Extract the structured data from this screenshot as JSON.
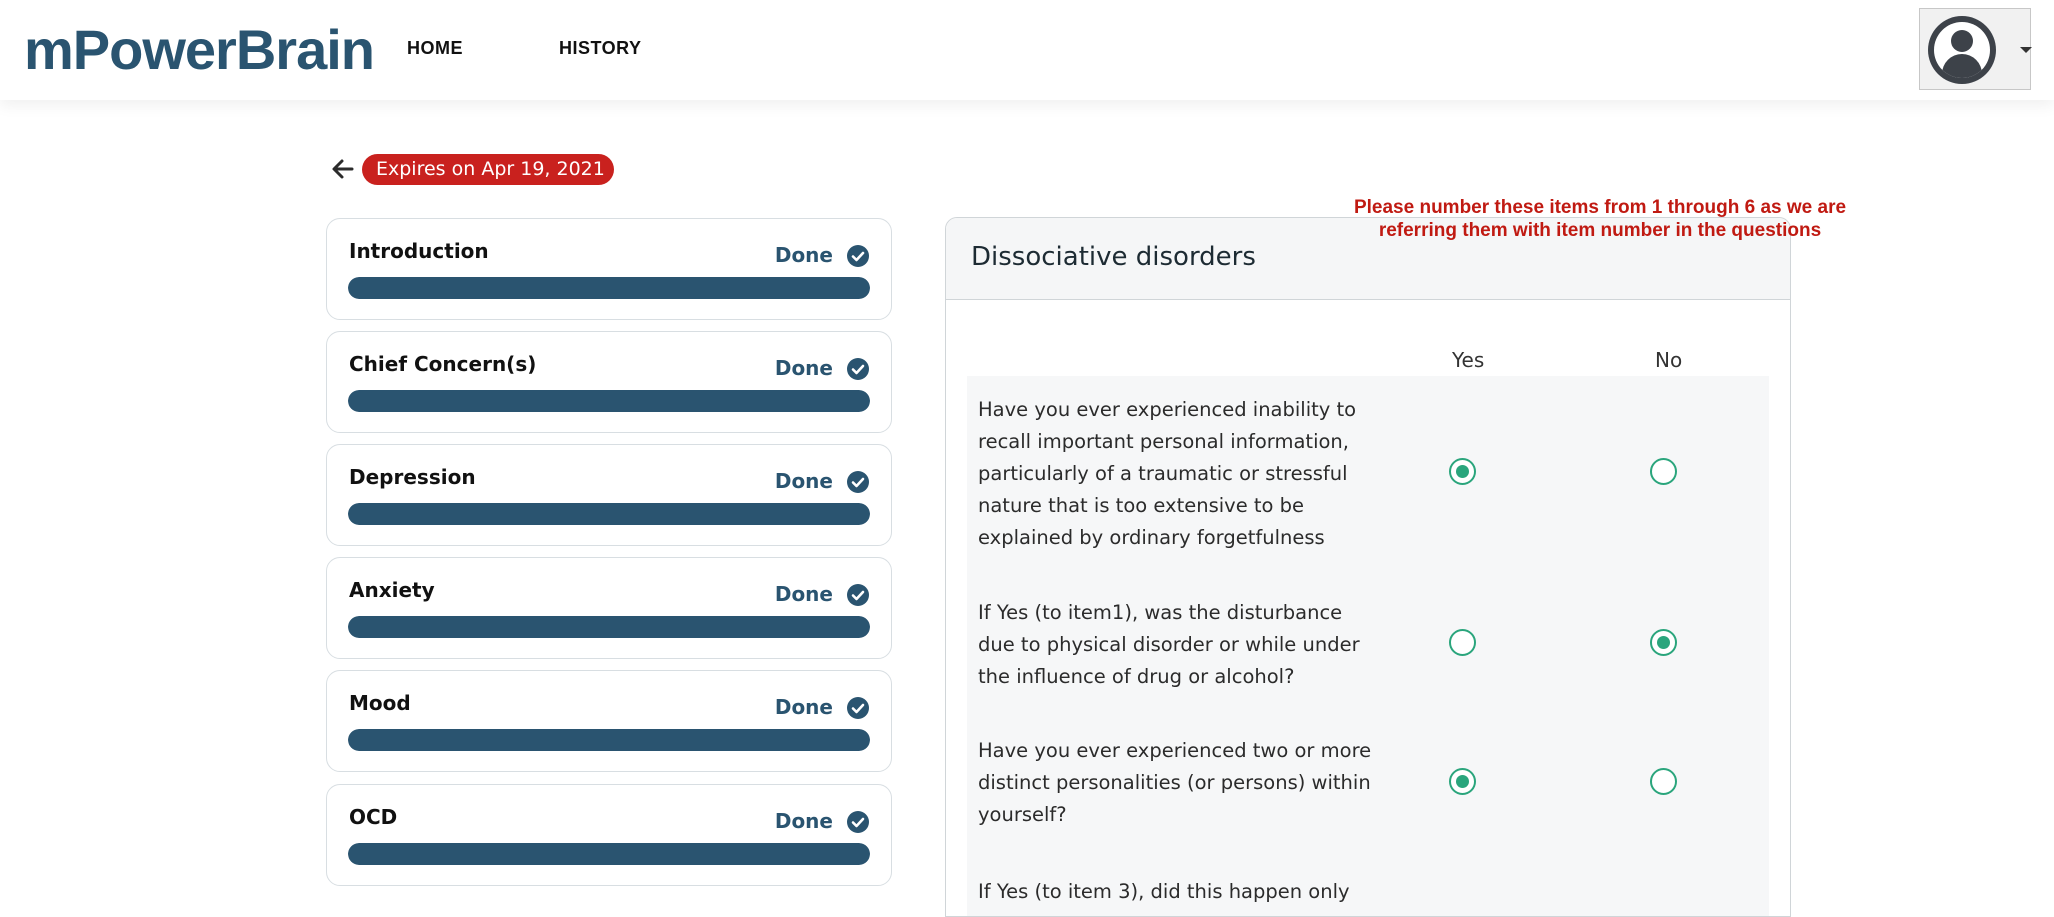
{
  "brand": {
    "name": "mPowerBrain"
  },
  "nav": {
    "home": "HOME",
    "history": "HISTORY"
  },
  "expires": {
    "label": "Expires on Apr 19, 2021"
  },
  "steps": [
    {
      "title": "Introduction",
      "status": "Done",
      "progress": 1.0
    },
    {
      "title": "Chief Concern(s)",
      "status": "Done",
      "progress": 1.0
    },
    {
      "title": "Depression",
      "status": "Done",
      "progress": 1.0
    },
    {
      "title": "Anxiety",
      "status": "Done",
      "progress": 1.0
    },
    {
      "title": "Mood",
      "status": "Done",
      "progress": 1.0
    },
    {
      "title": "OCD",
      "status": "Done",
      "progress": 1.0
    }
  ],
  "questionnaire": {
    "title": "Dissociative disorders",
    "columns": {
      "yes": "Yes",
      "no": "No"
    },
    "questions": [
      {
        "text": "Have you ever experienced inability to recall important personal information, particularly of a traumatic or stressful nature that is too extensive to be explained by ordinary forgetfulness",
        "answer": "yes"
      },
      {
        "text": "If Yes (to item1), was the disturbance due to physical disorder or while under the influence of drug or alcohol?",
        "answer": "no"
      },
      {
        "text": "Have you ever experienced two or more distinct personalities (or persons) within yourself?",
        "answer": "yes"
      },
      {
        "text": "If Yes (to item 3), did this happen only",
        "answer": ""
      }
    ]
  },
  "annotation": {
    "text": "Please number these items from 1 through 6 as we are referring them with item number in the questions"
  },
  "colors": {
    "brand": "#2a5470",
    "badge": "#c9211e",
    "radio": "#2aa57c",
    "annotation": "#c01a12"
  }
}
